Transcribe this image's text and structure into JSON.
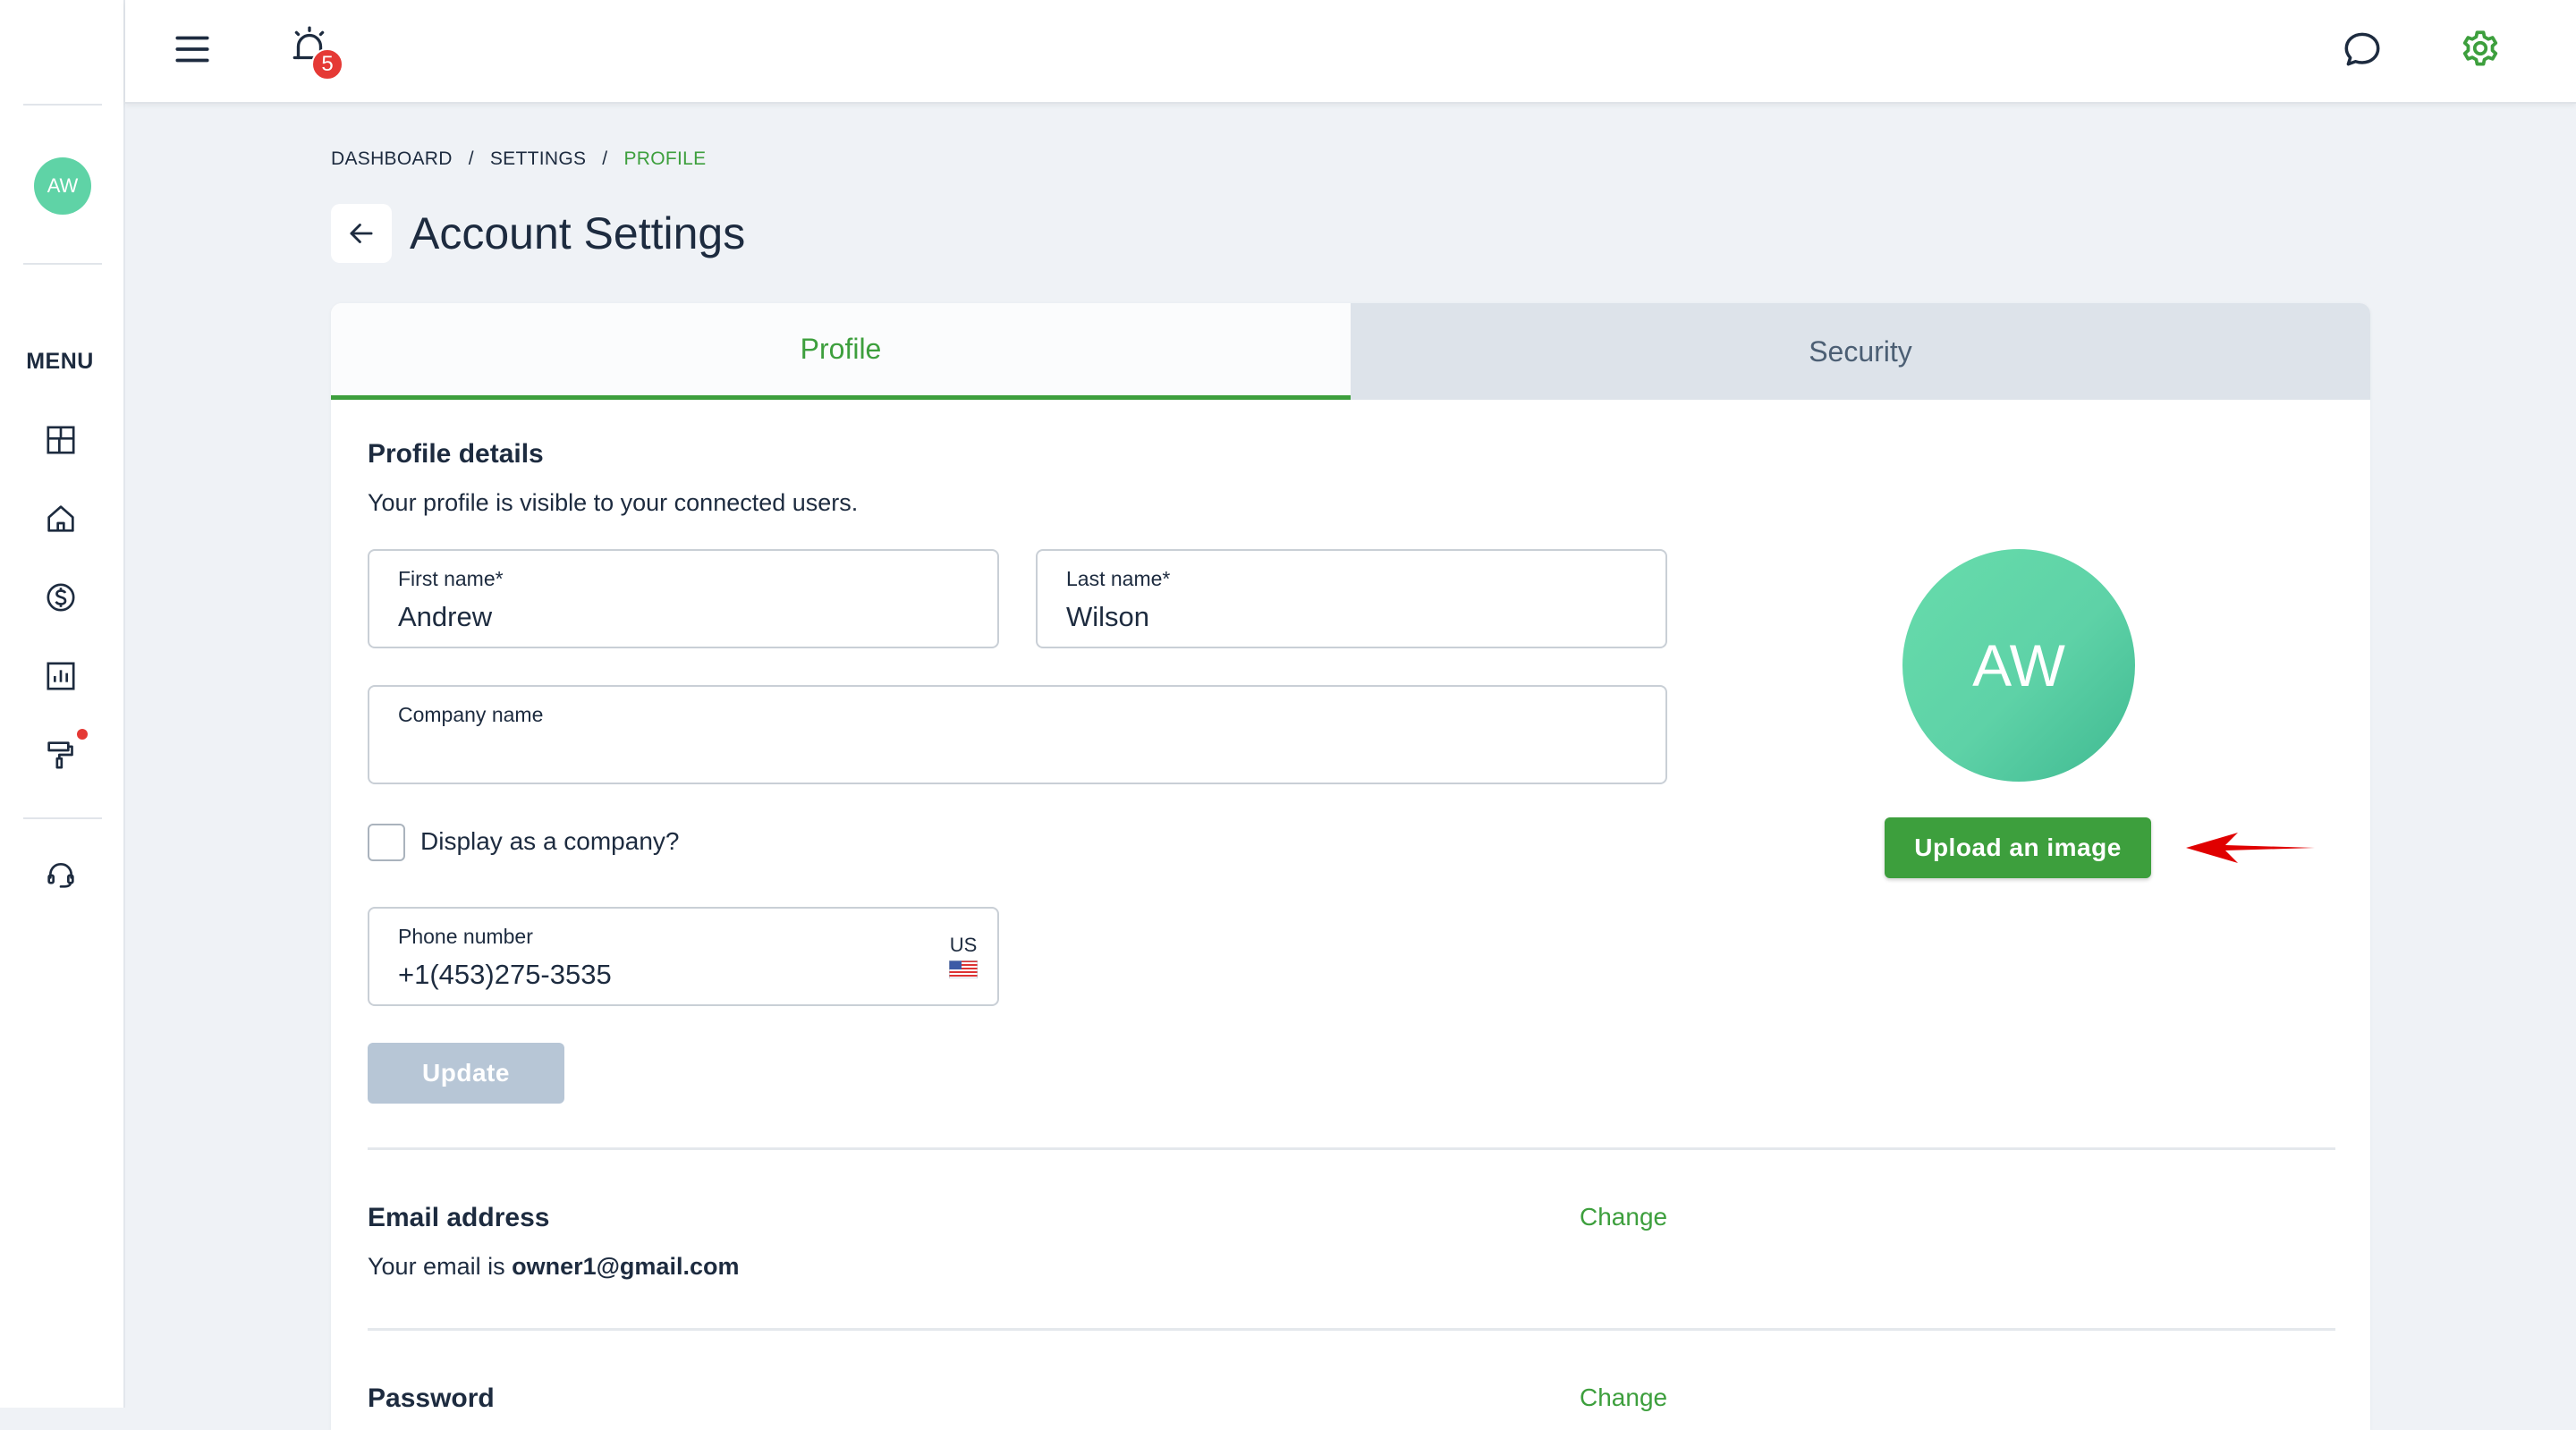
{
  "sidebar": {
    "avatar_initials": "AW",
    "menu_label": "MENU",
    "items": [
      {
        "name": "dashboard-icon"
      },
      {
        "name": "home-icon"
      },
      {
        "name": "dollar-icon"
      },
      {
        "name": "chart-icon"
      },
      {
        "name": "paint-roller-icon"
      },
      {
        "name": "headset-icon"
      }
    ]
  },
  "topbar": {
    "notification_count": "5"
  },
  "breadcrumb": {
    "items": [
      "DASHBOARD",
      "SETTINGS",
      "PROFILE"
    ],
    "separator": "/"
  },
  "page_title": "Account Settings",
  "tabs": [
    {
      "label": "Profile",
      "active": true
    },
    {
      "label": "Security",
      "active": false
    }
  ],
  "profile": {
    "title": "Profile details",
    "subtitle": "Your profile is visible to your connected users.",
    "first_name": {
      "label": "First name*",
      "value": "Andrew"
    },
    "last_name": {
      "label": "Last name*",
      "value": "Wilson"
    },
    "company_name": {
      "label": "Company name",
      "value": ""
    },
    "display_as_company_label": "Display as a company?",
    "phone": {
      "label": "Phone number",
      "value": "+1(453)275-3535",
      "country": "US"
    },
    "update_label": "Update",
    "avatar_initials": "AW",
    "upload_label": "Upload an image"
  },
  "email": {
    "title": "Email address",
    "change_label": "Change",
    "prefix": "Your email is ",
    "value": "owner1@gmail.com"
  },
  "password": {
    "title": "Password",
    "change_label": "Change"
  },
  "colors": {
    "accent": "#3d9f3d",
    "avatar": "#5fd3a6",
    "badge": "#e53935",
    "arrow": "#e00000"
  }
}
